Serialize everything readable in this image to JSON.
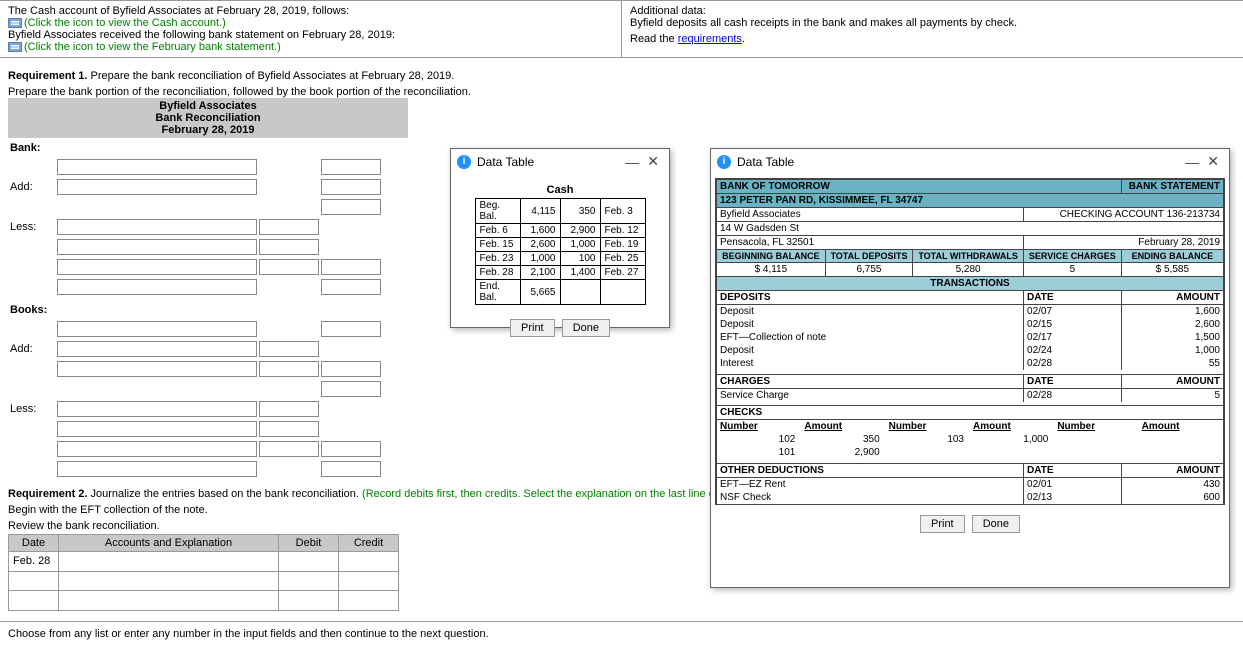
{
  "top": {
    "line1": "The Cash account of Byfield Associates at February 28, 2019, follows:",
    "link1": "(Click the icon to view the Cash account.)",
    "line2": "Byfield Associates received the following bank statement on February 28, 2019:",
    "link2": "(Click the icon to view the February bank statement.)",
    "add_data": "Additional data:",
    "add_line": "Byfield deposits all cash receipts in the bank and makes all payments by check.",
    "read_the": "Read the ",
    "requirements": "requirements"
  },
  "req1": {
    "heading": "Requirement 1.",
    "text": " Prepare the bank reconciliation of Byfield Associates at February 28, 2019.",
    "sub": "Prepare the bank portion of the reconciliation, followed by the book portion of the reconciliation.",
    "header1": "Byfield Associates",
    "header2": "Bank Reconciliation",
    "header3": "February 28, 2019",
    "bank": "Bank:",
    "add": "Add:",
    "less": "Less:",
    "books": "Books:"
  },
  "req2": {
    "heading": "Requirement 2.",
    "text": " Journalize the entries based on the bank reconciliation. ",
    "green": "(Record debits first, then credits. Select the explanation on the last line of the journal entry table.)",
    "line2": "Begin with the EFT collection of the note.",
    "line3": "Review the bank reconciliation.",
    "th_date": "Date",
    "th_acct": "Accounts and Explanation",
    "th_debit": "Debit",
    "th_credit": "Credit",
    "date": "Feb. 28"
  },
  "popup_cash": {
    "title": "Data Table",
    "header": "Cash",
    "rows_left": [
      {
        "label": "Beg. Bal.",
        "val": "4,115"
      },
      {
        "label": "Feb. 6",
        "val": "1,600"
      },
      {
        "label": "Feb. 15",
        "val": "2,600"
      },
      {
        "label": "Feb. 23",
        "val": "1,000"
      },
      {
        "label": "Feb. 28",
        "val": "2,100"
      },
      {
        "label": "End. Bal.",
        "val": "5,665"
      }
    ],
    "rows_right": [
      {
        "val": "350",
        "label": "Feb. 3"
      },
      {
        "val": "2,900",
        "label": "Feb. 12"
      },
      {
        "val": "1,000",
        "label": "Feb. 19"
      },
      {
        "val": "100",
        "label": "Feb. 25"
      },
      {
        "val": "1,400",
        "label": "Feb. 27"
      },
      {
        "val": "",
        "label": ""
      }
    ],
    "print": "Print",
    "done": "Done"
  },
  "popup_stmt": {
    "title": "Data Table",
    "bank_name": "BANK OF TOMORROW",
    "bank_stmt": "BANK STATEMENT",
    "addr": "123 PETER PAN RD, KISSIMMEE, FL 34747",
    "cust1": "Byfield Associates",
    "cust1_right": "CHECKING ACCOUNT 136-213734",
    "cust2": "14 W Gadsden St",
    "cust3": "Pensacola, FL 32501",
    "cust3_right": "February 28, 2019",
    "sh_beg": "BEGINNING BALANCE",
    "sh_dep": "TOTAL DEPOSITS",
    "sh_wd": "TOTAL WITHDRAWALS",
    "sh_svc": "SERVICE CHARGES",
    "sh_end": "ENDING BALANCE",
    "sv_beg": "$   4,115",
    "sv_dep": "6,755",
    "sv_wd": "5,280",
    "sv_svc": "5",
    "sv_end": "$   5,585",
    "transactions": "TRANSACTIONS",
    "deposits": "DEPOSITS",
    "date_h": "DATE",
    "amount_h": "AMOUNT",
    "dep_rows": [
      {
        "label": "Deposit",
        "date": "02/07",
        "amt": "1,600"
      },
      {
        "label": "Deposit",
        "date": "02/15",
        "amt": "2,600"
      },
      {
        "label": "EFT—Collection of note",
        "date": "02/17",
        "amt": "1,500"
      },
      {
        "label": "Deposit",
        "date": "02/24",
        "amt": "1,000"
      },
      {
        "label": "Interest",
        "date": "02/28",
        "amt": "55"
      }
    ],
    "charges": "CHARGES",
    "chg_rows": [
      {
        "label": "Service Charge",
        "date": "02/28",
        "amt": "5"
      }
    ],
    "checks": "CHECKS",
    "number_h": "Number",
    "amount_h2": "Amount",
    "chk_rows": [
      {
        "n1": "102",
        "a1": "350",
        "n2": "103",
        "a2": "1,000",
        "n3": "",
        "a3": ""
      },
      {
        "n1": "101",
        "a1": "2,900",
        "n2": "",
        "a2": "",
        "n3": "",
        "a3": ""
      }
    ],
    "other": "OTHER DEDUCTIONS",
    "oth_rows": [
      {
        "label": "EFT—EZ Rent",
        "date": "02/01",
        "amt": "430"
      },
      {
        "label": "NSF Check",
        "date": "02/13",
        "amt": "600"
      }
    ],
    "print": "Print",
    "done": "Done"
  },
  "footer": "Choose from any list or enter any number in the input fields and then continue to the next question."
}
